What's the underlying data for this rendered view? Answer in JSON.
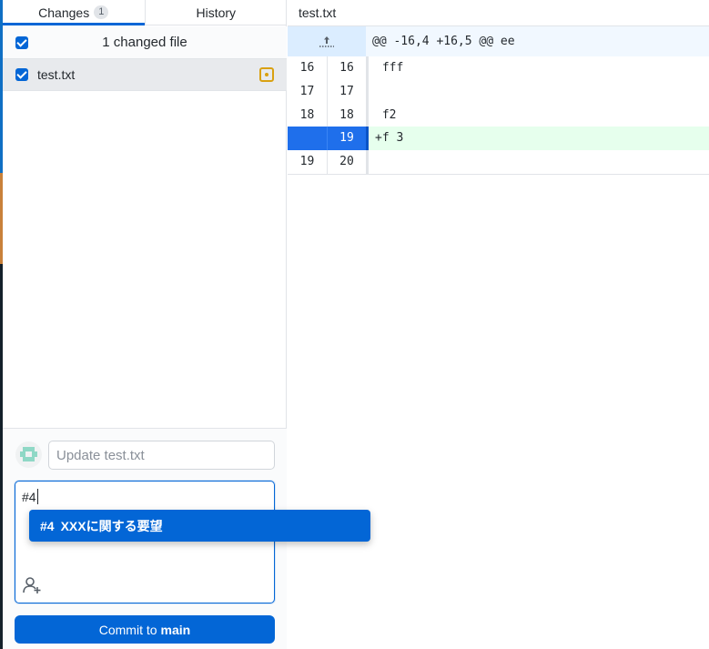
{
  "tabs": [
    {
      "label": "Changes",
      "count": "1"
    },
    {
      "label": "History"
    }
  ],
  "files": {
    "header_label": "1 changed file",
    "items": [
      {
        "name": "test.txt"
      }
    ]
  },
  "commit": {
    "summary_placeholder": "Update test.txt",
    "description_value": "#4",
    "button_prefix": "Commit to",
    "branch": "main"
  },
  "autocomplete": {
    "ref": "#4",
    "title": "XXXに関する要望"
  },
  "diff": {
    "file_name": "test.txt",
    "hunk_header": "@@ -16,4 +16,5 @@ ee",
    "lines": [
      {
        "old": "16",
        "new": "16",
        "text": " fff",
        "type": "context"
      },
      {
        "old": "17",
        "new": "17",
        "text": " ",
        "type": "context"
      },
      {
        "old": "18",
        "new": "18",
        "text": " f2",
        "type": "context"
      },
      {
        "old": "",
        "new": "19",
        "text": "+f 3",
        "type": "add"
      },
      {
        "old": "19",
        "new": "20",
        "text": " ",
        "type": "context"
      }
    ]
  },
  "colors": {
    "accent": "#0366d6",
    "added_line_bg": "#e6ffed",
    "modified_icon": "#d9a112"
  }
}
